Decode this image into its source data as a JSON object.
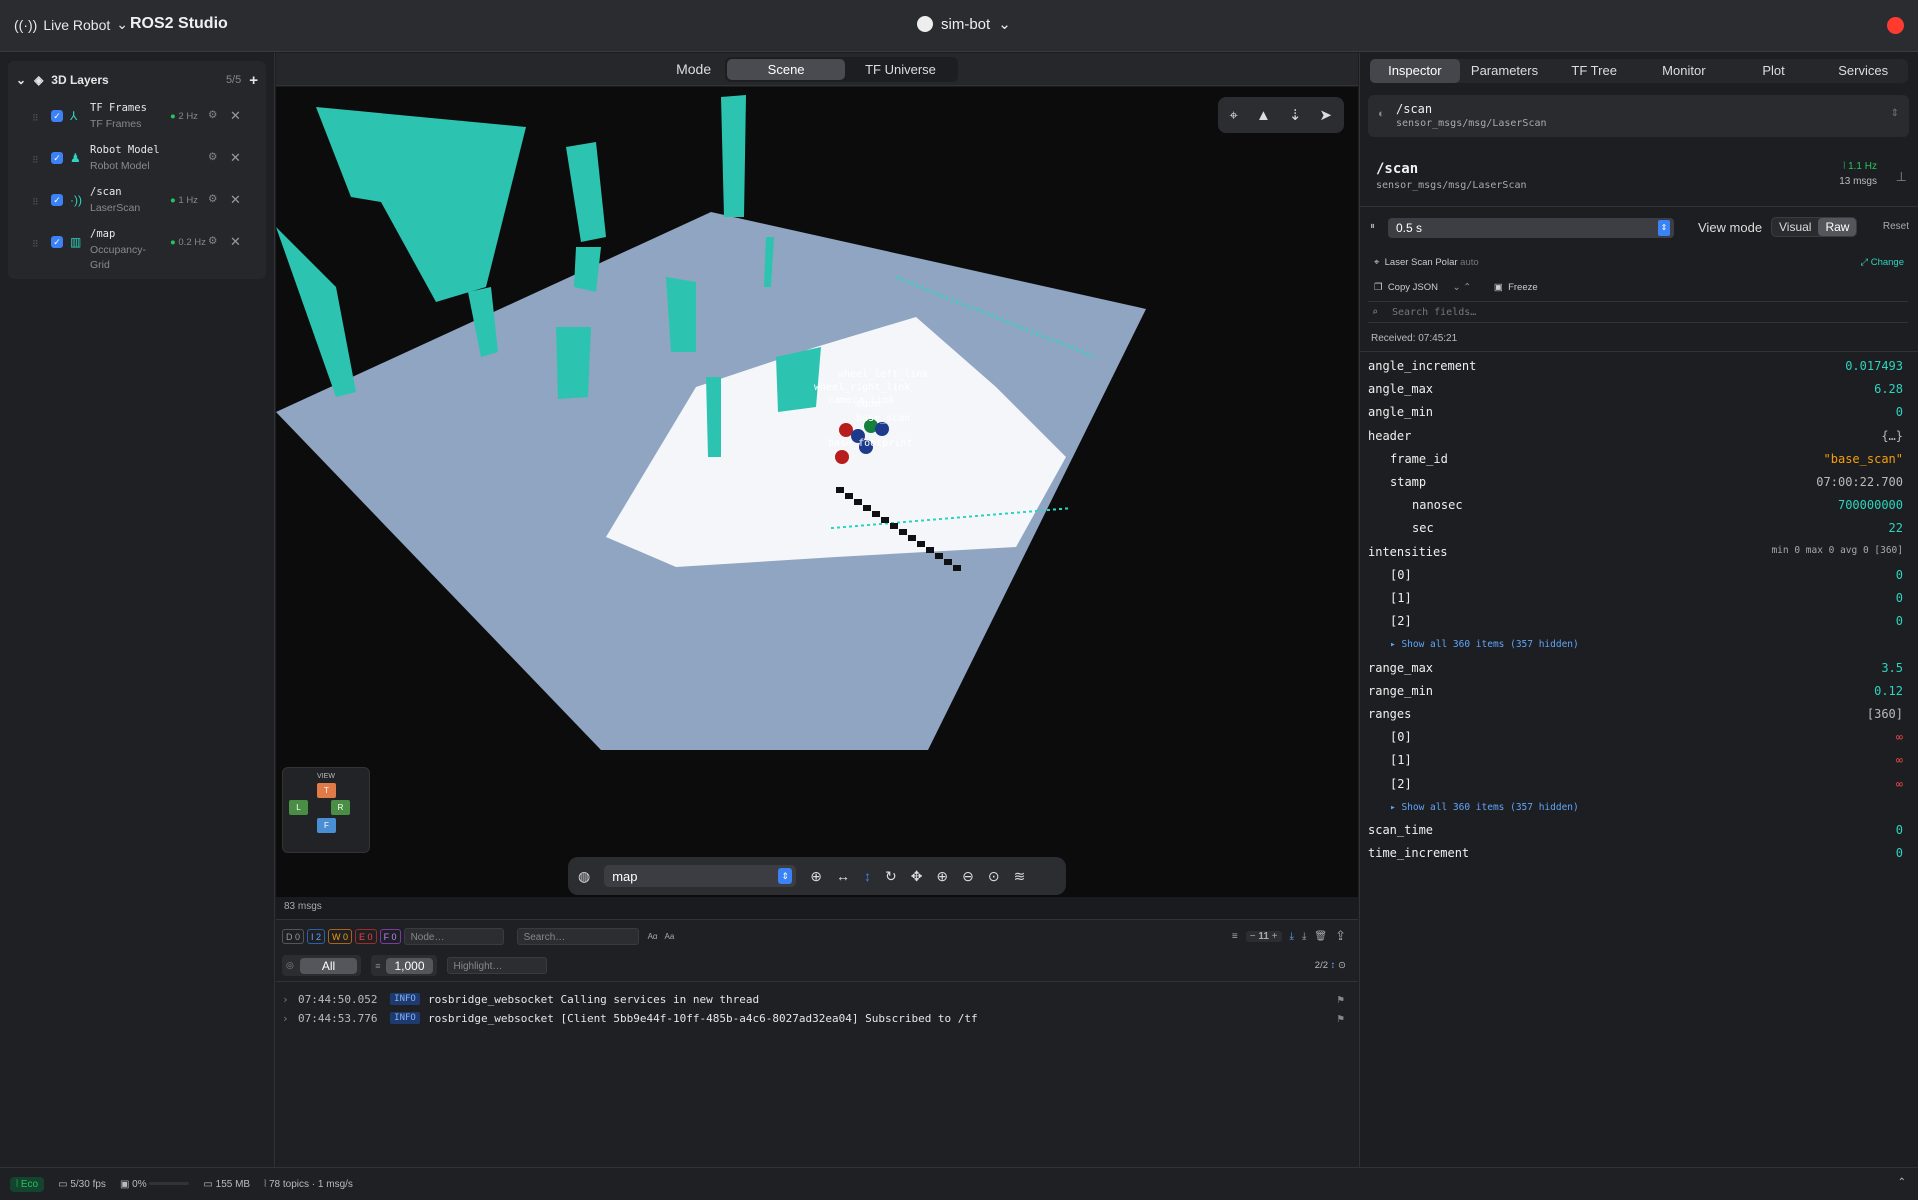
{
  "header": {
    "live_label": "Live Robot",
    "brand": "ROS2 Studio",
    "robot": "sim-bot"
  },
  "layers": {
    "title": "3D Layers",
    "count": "5/5",
    "items": [
      {
        "name": "TF Frames",
        "sub": "TF Frames",
        "hz": "2 Hz"
      },
      {
        "name": "Robot Model",
        "sub": "Robot Model",
        "hz": ""
      },
      {
        "name": "/scan",
        "sub": "LaserScan",
        "hz": "1 Hz"
      },
      {
        "name": "/map",
        "sub": "Occupancy-Grid",
        "hz": "0.2 Hz"
      }
    ]
  },
  "mode": {
    "label": "Mode",
    "tabs": [
      "Scene",
      "TF Universe"
    ],
    "active": "Scene"
  },
  "view": {
    "frame_labels": [
      "wheel_left_link",
      "wheel_right_link",
      "camera_link",
      "odom",
      "base_scan",
      "base_footprint"
    ],
    "viewcube": {
      "title": "VIEW",
      "T": "T",
      "L": "L",
      "R": "R",
      "F": "F"
    },
    "fixed_frame": "map",
    "msg_count": "83 msgs"
  },
  "console": {
    "levels": [
      "D 0",
      "I 2",
      "W 0",
      "E 0",
      "F 0"
    ],
    "node_placeholder": "Node…",
    "search_placeholder": "Search…",
    "aa1": "Aα",
    "aa2": "Aa",
    "limit": "11",
    "filter_all": "All",
    "buffer": "1,000",
    "highlight_placeholder": "Highlight…",
    "pages": "2/2",
    "logs": [
      {
        "ts": "07:44:50.052",
        "lvl": "INFO",
        "msg": "rosbridge_websocket Calling services in new thread"
      },
      {
        "ts": "07:44:53.776",
        "lvl": "INFO",
        "msg": "rosbridge_websocket [Client 5bb9e44f-10ff-485b-a4c6-8027ad32ea04] Subscribed to /tf"
      }
    ]
  },
  "inspector": {
    "tabs": [
      "Inspector",
      "Parameters",
      "TF Tree",
      "Monitor",
      "Plot",
      "Services"
    ],
    "topic": "/scan",
    "type": "sensor_msgs/msg/LaserScan",
    "hz": "1.1 Hz",
    "msgs": "13 msgs",
    "window": "0.5 s",
    "view_mode": "View mode",
    "visual": "Visual",
    "raw": "Raw",
    "reset": "Reset",
    "viz": "Laser Scan Polar",
    "viz_auto": "auto",
    "change": "Change",
    "copy": "Copy JSON",
    "freeze": "Freeze",
    "search_placeholder": "Search fields…",
    "received": "Received: 07:45:21",
    "fields": [
      {
        "k": "angle_increment",
        "v": "0.017493",
        "d": 0
      },
      {
        "k": "angle_max",
        "v": "6.28",
        "d": 0
      },
      {
        "k": "angle_min",
        "v": "0",
        "d": 0
      },
      {
        "k": "header",
        "v": "{…}",
        "d": 0,
        "c": "br"
      },
      {
        "k": "frame_id",
        "v": "\"base_scan\"",
        "d": 1,
        "c": "str"
      },
      {
        "k": "stamp",
        "v": "07:00:22.700",
        "d": 1,
        "c": "br2"
      },
      {
        "k": "nanosec",
        "v": "700000000",
        "d": 2
      },
      {
        "k": "sec",
        "v": "22",
        "d": 2
      },
      {
        "k": "intensities",
        "v": "min 0   max 0   avg 0 [360]",
        "d": 0,
        "c": "meta"
      },
      {
        "k": "[0]",
        "v": "0",
        "d": 1
      },
      {
        "k": "[1]",
        "v": "0",
        "d": 1
      },
      {
        "k": "[2]",
        "v": "0",
        "d": 1
      },
      {
        "k": "",
        "more": "▸ Show all 360 items (357 hidden)",
        "d": 1
      },
      {
        "k": "range_max",
        "v": "3.5",
        "d": 0
      },
      {
        "k": "range_min",
        "v": "0.12",
        "d": 0
      },
      {
        "k": "ranges",
        "v": "[360]",
        "d": 0,
        "c": "br"
      },
      {
        "k": "[0]",
        "v": "∞",
        "d": 1,
        "c": "inf"
      },
      {
        "k": "[1]",
        "v": "∞",
        "d": 1,
        "c": "inf"
      },
      {
        "k": "[2]",
        "v": "∞",
        "d": 1,
        "c": "inf"
      },
      {
        "k": "",
        "more": "▸ Show all 360 items (357 hidden)",
        "d": 1
      },
      {
        "k": "scan_time",
        "v": "0",
        "d": 0
      },
      {
        "k": "time_increment",
        "v": "0",
        "d": 0
      }
    ]
  },
  "status": {
    "eco": "Eco",
    "fps": "5/30 fps",
    "cpu": "0%",
    "mem": "155 MB",
    "topics": "78 topics · 1 msg/s"
  }
}
